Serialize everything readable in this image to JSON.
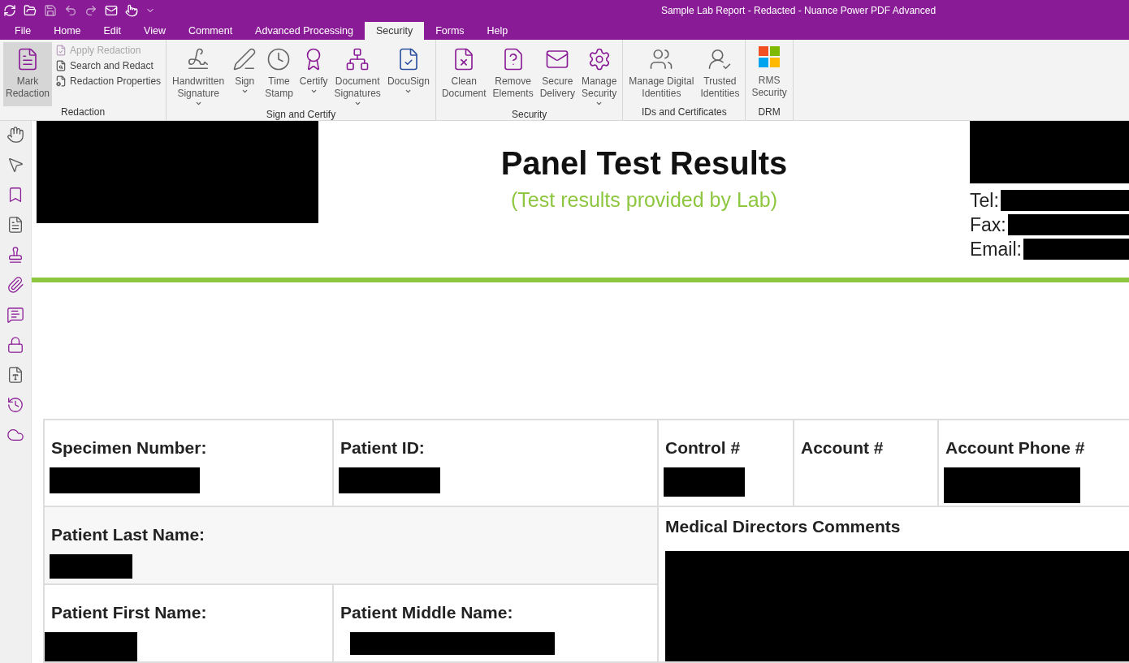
{
  "window": {
    "title": "Sample Lab Report - Redacted - Nuance Power PDF Advanced"
  },
  "menu_tabs": [
    {
      "label": "File",
      "selected": false
    },
    {
      "label": "Home",
      "selected": false
    },
    {
      "label": "Edit",
      "selected": false
    },
    {
      "label": "View",
      "selected": false
    },
    {
      "label": "Comment",
      "selected": false
    },
    {
      "label": "Advanced Processing",
      "selected": false
    },
    {
      "label": "Security",
      "selected": true
    },
    {
      "label": "Forms",
      "selected": false
    },
    {
      "label": "Help",
      "selected": false
    }
  ],
  "ribbon_groups": [
    {
      "title": "Redaction",
      "large": [
        {
          "label": "Mark\nRedaction",
          "selected": true,
          "dropdown": false
        }
      ],
      "small": [
        {
          "label": "Apply Redaction",
          "disabled": true
        },
        {
          "label": "Search and Redact",
          "disabled": false
        },
        {
          "label": "Redaction Properties",
          "disabled": false
        }
      ]
    },
    {
      "title": "Sign and Certify",
      "large": [
        {
          "label": "Handwritten\nSignature",
          "selected": false,
          "dropdown": true
        },
        {
          "label": "Sign",
          "selected": false,
          "dropdown": true
        },
        {
          "label": "Time\nStamp",
          "selected": false,
          "dropdown": false
        },
        {
          "label": "Certify",
          "selected": false,
          "dropdown": true
        },
        {
          "label": "Document\nSignatures",
          "selected": false,
          "dropdown": true
        },
        {
          "label": "DocuSign",
          "selected": false,
          "dropdown": true
        }
      ]
    },
    {
      "title": "Security",
      "large": [
        {
          "label": "Clean\nDocument",
          "selected": false,
          "dropdown": false
        },
        {
          "label": "Remove\nElements",
          "selected": false,
          "dropdown": false
        },
        {
          "label": "Secure\nDelivery",
          "selected": false,
          "dropdown": false
        },
        {
          "label": "Manage\nSecurity",
          "selected": false,
          "dropdown": true
        }
      ]
    },
    {
      "title": "IDs and Certificates",
      "large": [
        {
          "label": "Manage Digital\nIdentities",
          "selected": false,
          "dropdown": false
        },
        {
          "label": "Trusted\nIdentities",
          "selected": false,
          "dropdown": false
        }
      ]
    },
    {
      "title": "DRM",
      "large": [
        {
          "label": "RMS\nSecurity",
          "selected": false,
          "dropdown": false
        }
      ]
    }
  ],
  "document": {
    "heading": "Panel Test Results",
    "subheading": "(Test results provided by Lab)",
    "contact": [
      "Tel:",
      "Fax:",
      "Email:"
    ],
    "fields": [
      {
        "label": "Specimen Number:"
      },
      {
        "label": "Patient ID:"
      },
      {
        "label": "Control #"
      },
      {
        "label": "Account #"
      },
      {
        "label": "Account Phone #"
      },
      {
        "label": "Patient Last Name:"
      },
      {
        "label": "Medical Directors Comments"
      },
      {
        "label": "Patient First Name:"
      },
      {
        "label": "Patient Middle Name:"
      }
    ]
  }
}
